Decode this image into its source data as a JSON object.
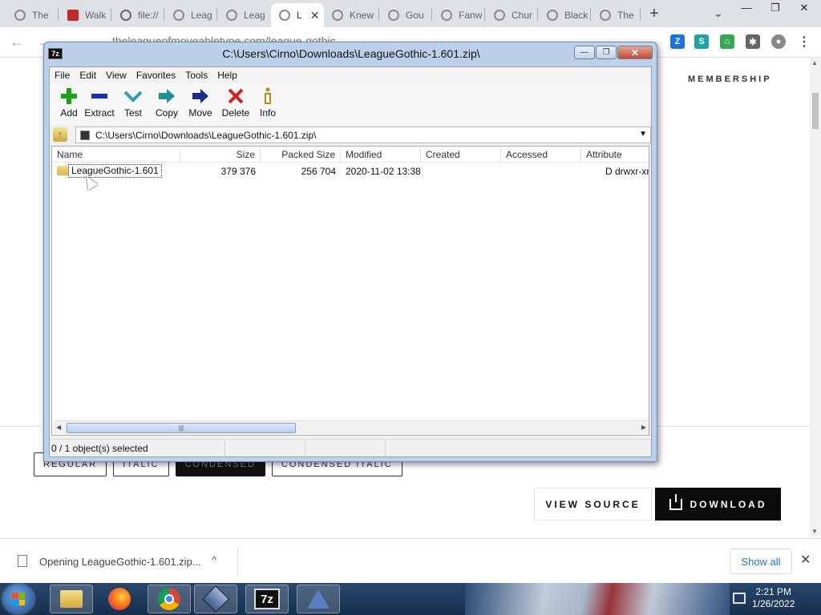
{
  "browser": {
    "tabs": [
      {
        "label": "The",
        "favicon": "site-icon"
      },
      {
        "label": "Walk",
        "favicon": "red-site-icon"
      },
      {
        "label": "file://",
        "favicon": "globe-icon"
      },
      {
        "label": "Leag",
        "favicon": "site-icon"
      },
      {
        "label": "Leag",
        "favicon": "site-icon"
      },
      {
        "label": "L",
        "favicon": "site-icon",
        "active": true
      },
      {
        "label": "Knew",
        "favicon": "site-icon"
      },
      {
        "label": "Gou",
        "favicon": "site-icon"
      },
      {
        "label": "Fanw",
        "favicon": "site-icon"
      },
      {
        "label": "Chur",
        "favicon": "site-icon"
      },
      {
        "label": "Black",
        "favicon": "site-icon"
      },
      {
        "label": "The",
        "favicon": "site-icon"
      }
    ],
    "new_tab": "+",
    "tab_search": "⌄",
    "window_controls": {
      "minimize": "—",
      "restore": "❐",
      "close": "✕"
    },
    "url": "theleagueofmoveabletype.com/league-gothic"
  },
  "page": {
    "membership": "MEMBERSHIP",
    "style_tabs": [
      {
        "label": "REGULAR",
        "selected": false
      },
      {
        "label": "ITALIC",
        "selected": false
      },
      {
        "label": "CONDENSED",
        "selected": true
      },
      {
        "label": "CONDENSED ITALIC",
        "selected": false
      }
    ],
    "view_source": "VIEW SOURCE",
    "download": "DOWNLOAD"
  },
  "download_shelf": {
    "file": "Opening LeagueGothic-1.601.zip...",
    "caret": "^",
    "show_all": "Show all",
    "close": "✕"
  },
  "sevenzip": {
    "title": "C:\\Users\\Cirno\\Downloads\\LeagueGothic-1.601.zip\\",
    "icon_text": "7z",
    "menu": [
      "File",
      "Edit",
      "View",
      "Favorites",
      "Tools",
      "Help"
    ],
    "tools": [
      {
        "label": "Add",
        "icon": "plus-icon",
        "color": "#1aa31a"
      },
      {
        "label": "Extract",
        "icon": "minus-icon",
        "color": "#1a2fbf"
      },
      {
        "label": "Test",
        "icon": "check-icon",
        "color": "#2aa0b5"
      },
      {
        "label": "Copy",
        "icon": "copy-arrow-icon",
        "color": "#1f8f8f"
      },
      {
        "label": "Move",
        "icon": "move-arrow-icon",
        "color": "#1a2a8f"
      },
      {
        "label": "Delete",
        "icon": "delete-x-icon",
        "color": "#d42020"
      },
      {
        "label": "Info",
        "icon": "info-icon",
        "color": "#b88a10"
      }
    ],
    "path": "C:\\Users\\Cirno\\Downloads\\LeagueGothic-1.601.zip\\",
    "columns": [
      "Name",
      "Size",
      "Packed Size",
      "Modified",
      "Created",
      "Accessed",
      "Attribute"
    ],
    "rows": [
      {
        "name": "LeagueGothic-1.601",
        "size": "379 376",
        "packed": "256 704",
        "modified": "2020-11-02 13:38",
        "created": "",
        "accessed": "",
        "attributes": "D drwxr-xr-"
      }
    ],
    "status": "0 / 1 object(s) selected"
  },
  "taskbar": {
    "time": "2:21 PM",
    "date": "1/26/2022",
    "apps": [
      "file-explorer-icon",
      "firefox-icon",
      "chrome-icon",
      "virtualbox-icon",
      "7zip-icon",
      "inkscape-icon"
    ],
    "sevenzip_label": "7z"
  }
}
